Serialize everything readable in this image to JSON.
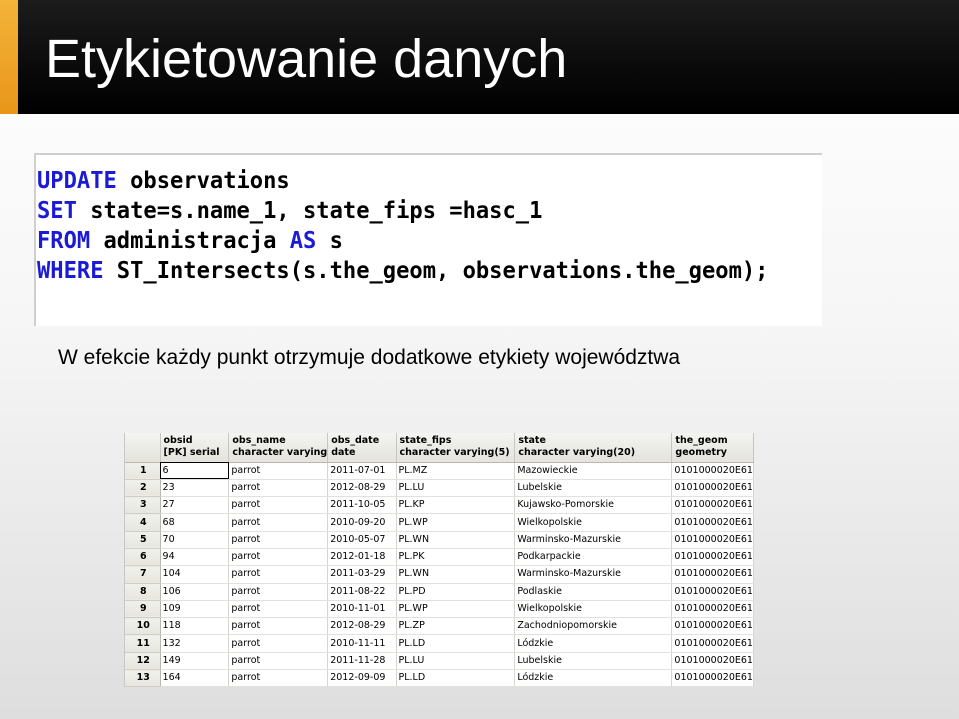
{
  "slide": {
    "title": "Etykietowanie danych",
    "caption": "W efekcie każdy punkt otrzymuje dodatkowe etykiety województwa"
  },
  "sql": {
    "line1": {
      "kw": "UPDATE",
      "rest": " observations"
    },
    "line2": {
      "kw": "SET",
      "rest": " state=s.name_1, state_fips =hasc_1"
    },
    "line3": {
      "kw1": "FROM",
      "mid": " administracja ",
      "kw2": "AS",
      "rest": " s"
    },
    "line4": {
      "kw": "WHERE",
      "rest": " ST_Intersects(s.the_geom, observations.the_geom);"
    }
  },
  "grid": {
    "columns": [
      {
        "name": "obsid",
        "type": "[PK] serial"
      },
      {
        "name": "obs_name",
        "type": "character varying"
      },
      {
        "name": "obs_date",
        "type": "date"
      },
      {
        "name": "state_fips",
        "type": "character varying(5)"
      },
      {
        "name": "state",
        "type": "character varying(20)"
      },
      {
        "name": "the_geom",
        "type": "geometry"
      }
    ],
    "rows": [
      {
        "n": "1",
        "obsid": "6",
        "obs_name": "parrot",
        "obs_date": "2011-07-01",
        "state_fips": "PL.MZ",
        "state": "Mazowieckie",
        "the_geom": "0101000020E61"
      },
      {
        "n": "2",
        "obsid": "23",
        "obs_name": "parrot",
        "obs_date": "2012-08-29",
        "state_fips": "PL.LU",
        "state": "Lubelskie",
        "the_geom": "0101000020E61"
      },
      {
        "n": "3",
        "obsid": "27",
        "obs_name": "parrot",
        "obs_date": "2011-10-05",
        "state_fips": "PL.KP",
        "state": "Kujawsko-Pomorskie",
        "the_geom": "0101000020E61"
      },
      {
        "n": "4",
        "obsid": "68",
        "obs_name": "parrot",
        "obs_date": "2010-09-20",
        "state_fips": "PL.WP",
        "state": "Wielkopolskie",
        "the_geom": "0101000020E61"
      },
      {
        "n": "5",
        "obsid": "70",
        "obs_name": "parrot",
        "obs_date": "2010-05-07",
        "state_fips": "PL.WN",
        "state": "Warminsko-Mazurskie",
        "the_geom": "0101000020E61"
      },
      {
        "n": "6",
        "obsid": "94",
        "obs_name": "parrot",
        "obs_date": "2012-01-18",
        "state_fips": "PL.PK",
        "state": "Podkarpackie",
        "the_geom": "0101000020E61"
      },
      {
        "n": "7",
        "obsid": "104",
        "obs_name": "parrot",
        "obs_date": "2011-03-29",
        "state_fips": "PL.WN",
        "state": "Warminsko-Mazurskie",
        "the_geom": "0101000020E61"
      },
      {
        "n": "8",
        "obsid": "106",
        "obs_name": "parrot",
        "obs_date": "2011-08-22",
        "state_fips": "PL.PD",
        "state": "Podlaskie",
        "the_geom": "0101000020E61"
      },
      {
        "n": "9",
        "obsid": "109",
        "obs_name": "parrot",
        "obs_date": "2010-11-01",
        "state_fips": "PL.WP",
        "state": "Wielkopolskie",
        "the_geom": "0101000020E61"
      },
      {
        "n": "10",
        "obsid": "118",
        "obs_name": "parrot",
        "obs_date": "2012-08-29",
        "state_fips": "PL.ZP",
        "state": "Zachodniopomorskie",
        "the_geom": "0101000020E61"
      },
      {
        "n": "11",
        "obsid": "132",
        "obs_name": "parrot",
        "obs_date": "2010-11-11",
        "state_fips": "PL.LD",
        "state": "Lódzkie",
        "the_geom": "0101000020E61"
      },
      {
        "n": "12",
        "obsid": "149",
        "obs_name": "parrot",
        "obs_date": "2011-11-28",
        "state_fips": "PL.LU",
        "state": "Lubelskie",
        "the_geom": "0101000020E61"
      },
      {
        "n": "13",
        "obsid": "164",
        "obs_name": "parrot",
        "obs_date": "2012-09-09",
        "state_fips": "PL.LD",
        "state": "Lódzkie",
        "the_geom": "0101000020E61"
      }
    ]
  },
  "colors": {
    "title_bg": "#000000",
    "title_accent": "#e8961a",
    "sql_keyword": "#1b1bd6"
  }
}
